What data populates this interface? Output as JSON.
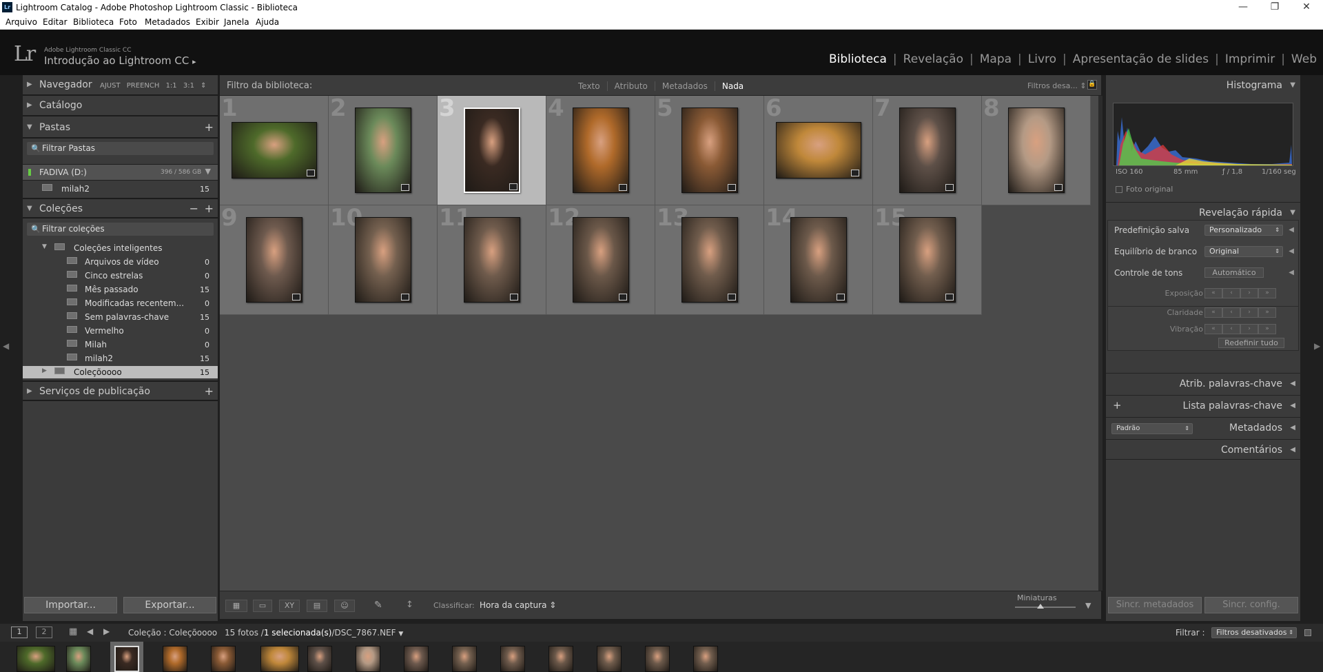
{
  "window": {
    "title": "Lightroom Catalog - Adobe Photoshop Lightroom Classic - Biblioteca",
    "logo": "Lr",
    "controls": [
      "—",
      "❐",
      "✕"
    ]
  },
  "menu": [
    "Arquivo",
    "Editar",
    "Biblioteca",
    "Foto",
    "Metadados",
    "Exibir",
    "Janela",
    "Ajuda"
  ],
  "identity": {
    "logo": "Lr",
    "product": "Adobe Lightroom Classic CC",
    "plate": "Introdução ao Lightroom CC",
    "arrow": "▸"
  },
  "modules": [
    "Biblioteca",
    "Revelação",
    "Mapa",
    "Livro",
    "Apresentação de slides",
    "Imprimir",
    "Web"
  ],
  "left": {
    "navigator": {
      "label": "Navegador",
      "zoom": [
        "AJUST",
        "PREENCH",
        "1:1",
        "3:1"
      ]
    },
    "catalog": {
      "label": "Catálogo"
    },
    "folders": {
      "label": "Pastas",
      "filter": "Filtrar Pastas",
      "volume": "FADIVA (D:)",
      "volume_size": "396 / 586 GB",
      "folder": "milah2",
      "folder_count": "15"
    },
    "collections": {
      "label": "Coleções",
      "filter": "Filtrar coleções",
      "smart": "Coleções inteligentes",
      "items": [
        {
          "name": "Arquivos de vídeo",
          "count": "0"
        },
        {
          "name": "Cinco estrelas",
          "count": "0"
        },
        {
          "name": "Mês passado",
          "count": "15"
        },
        {
          "name": "Modificadas recentem...",
          "count": "0"
        },
        {
          "name": "Sem palavras-chave",
          "count": "15"
        },
        {
          "name": "Vermelho",
          "count": "0"
        },
        {
          "name": "Milah",
          "count": "0"
        },
        {
          "name": "milah2",
          "count": "15"
        }
      ],
      "selected": {
        "name": "Coleçõoooo",
        "count": "15"
      }
    },
    "publish": {
      "label": "Serviços de publicação"
    },
    "import": "Importar...",
    "export": "Exportar..."
  },
  "filterbar": {
    "label": "Filtro da biblioteca:",
    "tabs": [
      "Texto",
      "Atributo",
      "Metadados",
      "Nada"
    ],
    "preset": "Filtros desa..."
  },
  "grid": {
    "selected_index": 2,
    "cells": [
      {
        "n": "1",
        "orient": "land",
        "tone": "#4e6a2a"
      },
      {
        "n": "2",
        "orient": "port",
        "tone": "#6b8a5a"
      },
      {
        "n": "3",
        "orient": "port",
        "tone": "#3a2a22"
      },
      {
        "n": "4",
        "orient": "port",
        "tone": "#b06a2a"
      },
      {
        "n": "5",
        "orient": "port",
        "tone": "#8a5a35"
      },
      {
        "n": "6",
        "orient": "land",
        "tone": "#c0883a"
      },
      {
        "n": "7",
        "orient": "port",
        "tone": "#5e5048"
      },
      {
        "n": "8",
        "orient": "port",
        "tone": "#b49a85"
      },
      {
        "n": "9",
        "orient": "port",
        "tone": "#6e5a4e"
      },
      {
        "n": "10",
        "orient": "port",
        "tone": "#74604f"
      },
      {
        "n": "11",
        "orient": "port",
        "tone": "#6f5b4c"
      },
      {
        "n": "12",
        "orient": "port",
        "tone": "#6b5849"
      },
      {
        "n": "13",
        "orient": "port",
        "tone": "#705c4c"
      },
      {
        "n": "14",
        "orient": "port",
        "tone": "#6d5a4b"
      },
      {
        "n": "15",
        "orient": "port",
        "tone": "#725e4e"
      }
    ]
  },
  "toolbar": {
    "sort_label": "Classificar:",
    "sort_value": "Hora da captura",
    "thumbs_label": "Miniaturas",
    "thumbs_level": 0.42,
    "view_icons": [
      "▦",
      "▭",
      "XY",
      "▤",
      "☺"
    ],
    "spray_icon": "✎",
    "sort_icon": "↕"
  },
  "right": {
    "histogram": {
      "label": "Histograma",
      "iso": "ISO 160",
      "focal": "85 mm",
      "aperture": "ƒ / 1,8",
      "shutter": "1/160 seg",
      "original": "Foto original"
    },
    "quick": {
      "label": "Revelação rápida",
      "preset_label": "Predefinição salva",
      "preset_value": "Personalizado",
      "wb_label": "Equilíbrio de branco",
      "wb_value": "Original",
      "tone_label": "Controle de tons",
      "auto": "Automático",
      "exposure": "Exposição",
      "clarity": "Claridade",
      "vibrance": "Vibração",
      "reset": "Redefinir tudo",
      "steppers": [
        "«",
        "‹",
        "›",
        "»"
      ]
    },
    "keywording": "Atrib. palavras-chave",
    "keyword_list": "Lista palavras-chave",
    "metadata_preset": "Padrão",
    "metadata": "Metadados",
    "comments": "Comentários",
    "sync_meta": "Sincr. metadados",
    "sync_settings": "Sincr. config."
  },
  "status": {
    "screen1": "1",
    "screen2": "2",
    "source": "Coleção : Coleçõoooo",
    "count": "15 fotos /",
    "selected": "1 selecionada(s)",
    "file": "/DSC_7867.NEF",
    "filter_label": "Filtrar :",
    "filter_value": "Filtros desativados"
  },
  "filmstrip": {
    "tones": [
      "#4e6a2a",
      "#6b8a5a",
      "#3a2a22",
      "#b06a2a",
      "#8a5a35",
      "#c0883a",
      "#5e5048",
      "#b49a85",
      "#6e5a4e",
      "#74604f",
      "#6f5b4c",
      "#6b5849",
      "#705c4c",
      "#6d5a4b",
      "#725e4e"
    ],
    "selected_index": 2
  }
}
